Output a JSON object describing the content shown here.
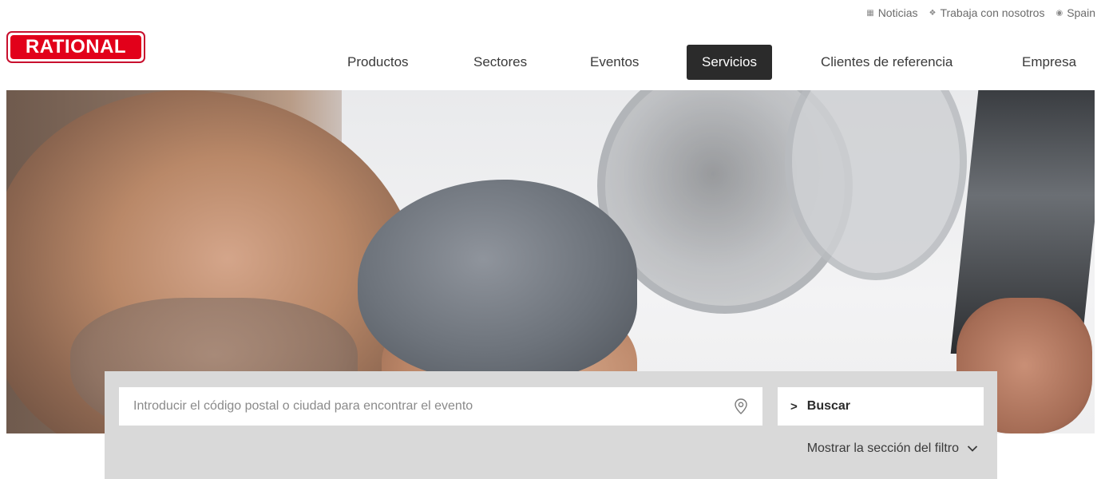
{
  "util_links": {
    "news": {
      "label": "Noticias",
      "icon": "newspaper-icon"
    },
    "careers": {
      "label": "Trabaja con nosotros",
      "icon": "handshake-icon"
    },
    "region": {
      "label": "Spain",
      "icon": "globe-icon"
    }
  },
  "logo": {
    "text": "RATIONAL",
    "color": "#e2001a"
  },
  "nav": {
    "items": [
      {
        "label": "Productos"
      },
      {
        "label": "Sectores"
      },
      {
        "label": "Eventos"
      },
      {
        "label": "Servicios",
        "active": true
      },
      {
        "label": "Clientes de referencia"
      },
      {
        "label": "Empresa"
      }
    ]
  },
  "search": {
    "placeholder": "Introducir el código postal o ciudad para encontrar el evento",
    "value": "",
    "button_label": "Buscar",
    "filter_label": "Mostrar la sección del filtro"
  },
  "colors": {
    "brand_red": "#e2001a",
    "nav_active_bg": "#2b2b2b",
    "panel_bg": "#d9d9d9"
  }
}
